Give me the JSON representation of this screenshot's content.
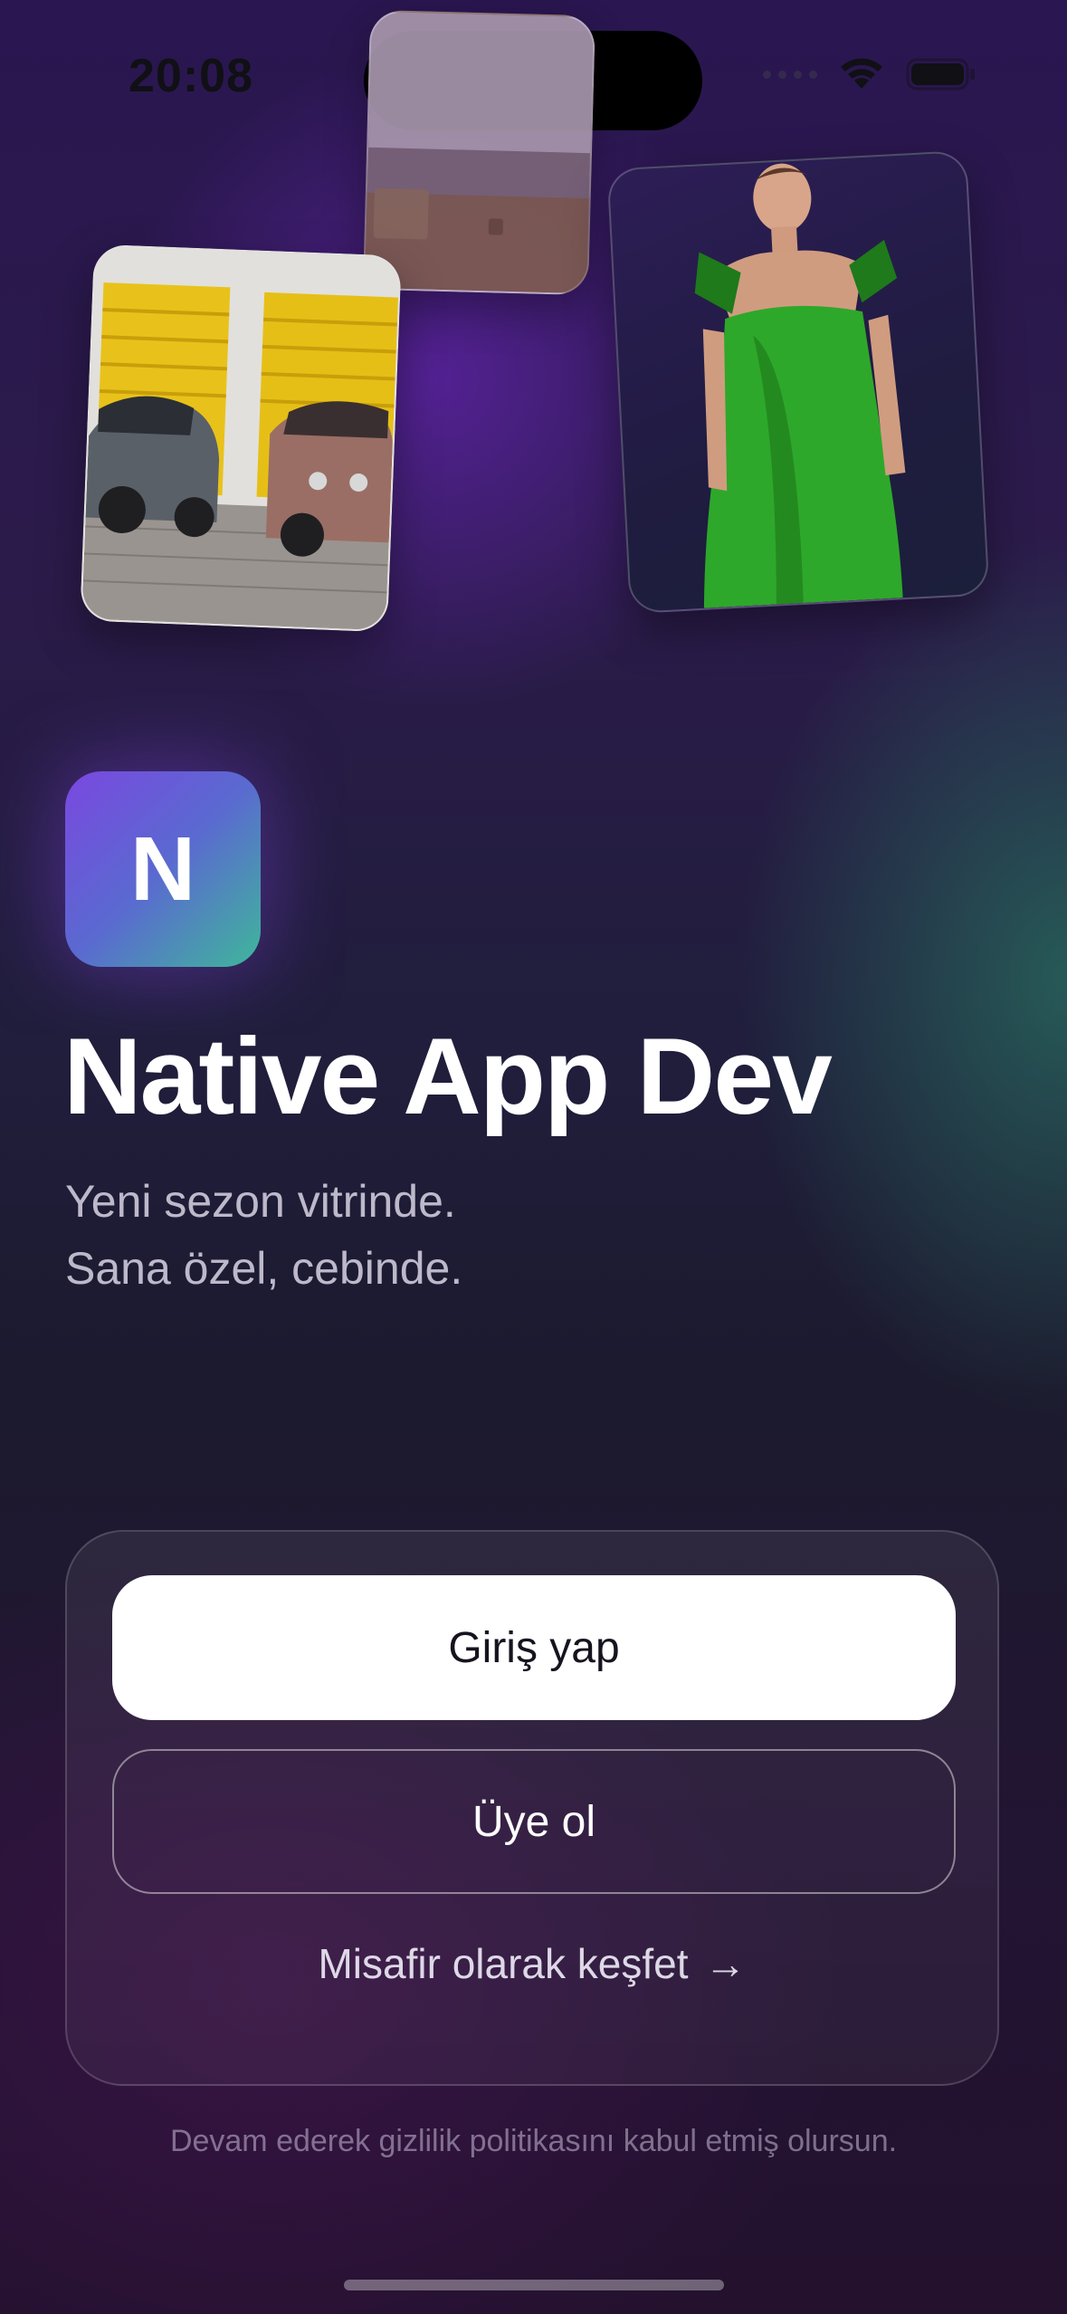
{
  "status_bar": {
    "time": "20:08",
    "icons": [
      "signal-icon",
      "wifi-icon",
      "battery-icon"
    ]
  },
  "photos": [
    {
      "name": "photo-landscape",
      "description": "hay bale field"
    },
    {
      "name": "photo-vintage-cars",
      "description": "two vintage cars in front of yellow garage doors"
    },
    {
      "name": "photo-green-dress",
      "description": "woman in green dress"
    }
  ],
  "brand": {
    "logo_letter": "N",
    "app_name": "Native App Dev",
    "tagline_line1": "Yeni sezon vitrinde.",
    "tagline_line2": "Sana özel, cebinde."
  },
  "actions": {
    "login_label": "Giriş yap",
    "signup_label": "Üye ol",
    "guest_label": "Misafir olarak keşfet",
    "guest_arrow": "→"
  },
  "footer": {
    "privacy_text": "Devam ederek gizlilik politikasını kabul etmiş olursun."
  },
  "colors": {
    "accent_purple": "#7a48e0",
    "accent_teal": "#3fb79a",
    "background": "#1d1230"
  }
}
